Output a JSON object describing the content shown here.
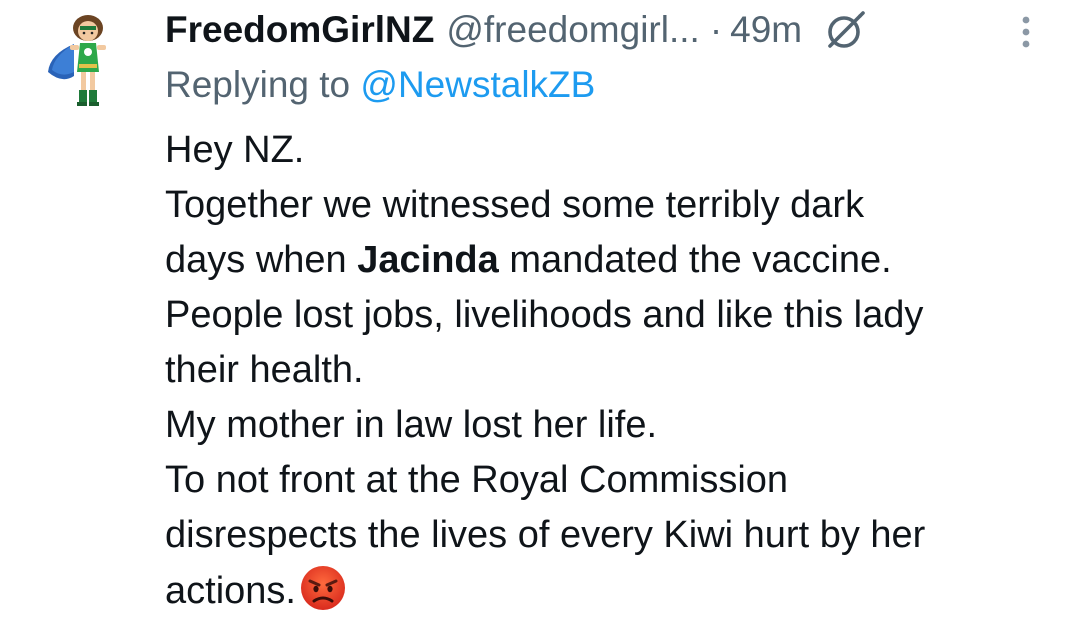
{
  "author": {
    "display_name": "FreedomGirlNZ",
    "handle": "@freedomgirl...",
    "separator": "·",
    "time": "49m"
  },
  "reply": {
    "prefix": "Replying to ",
    "mention": "@NewstalkZB"
  },
  "body": {
    "line1": "Hey NZ.",
    "line2": "Together we witnessed some terribly dark",
    "line3_before": "days when ",
    "line3_bold": "Jacinda",
    "line3_after": " mandated the vaccine.",
    "line4": "People lost jobs, livelihoods and like this lady",
    "line5": "their health.",
    "line6": "My mother in law lost her life.",
    "line7": "To not front at the Royal Commission",
    "line8": "disrespects the lives of every Kiwi hurt by her",
    "line9": "actions."
  },
  "icons": {
    "grok": "grok-icon",
    "more": "more-vertical-icon",
    "emoji": "angry-face-emoji",
    "avatar": "superhero-girl-avatar"
  },
  "colors": {
    "text": "#0f1419",
    "secondary": "#536471",
    "link": "#1d9bf0"
  }
}
